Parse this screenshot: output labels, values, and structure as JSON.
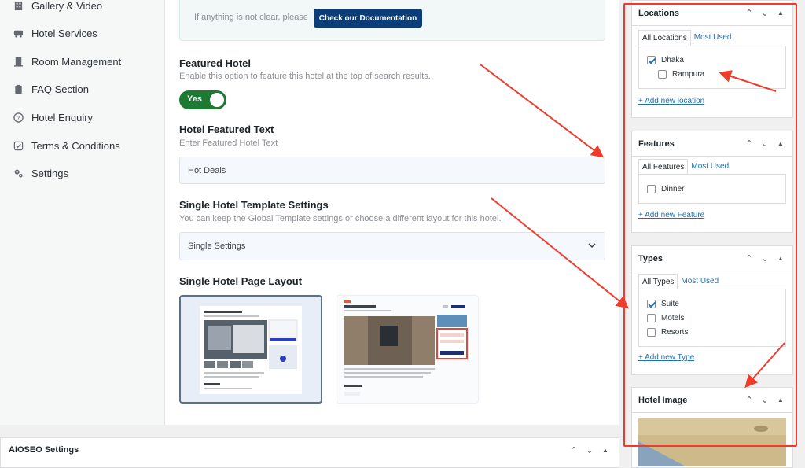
{
  "nav": {
    "items": [
      {
        "label": "Gallery & Video",
        "icon": "building-icon"
      },
      {
        "label": "Hotel Services",
        "icon": "bus-icon"
      },
      {
        "label": "Room Management",
        "icon": "door-icon"
      },
      {
        "label": "FAQ Section",
        "icon": "clipboard-icon"
      },
      {
        "label": "Hotel Enquiry",
        "icon": "question-icon"
      },
      {
        "label": "Terms & Conditions",
        "icon": "checkbox-icon"
      },
      {
        "label": "Settings",
        "icon": "gears-icon"
      }
    ]
  },
  "main": {
    "notice_text": "If anything is not clear, please",
    "doc_button": "Check our Documentation",
    "featured_title": "Featured Hotel",
    "featured_desc": "Enable this option to feature this hotel at the top of search results.",
    "toggle_label": "Yes",
    "featured_text_title": "Hotel Featured Text",
    "featured_text_desc": "Enter Featured Hotel Text",
    "featured_text_value": "Hot Deals",
    "template_title": "Single Hotel Template Settings",
    "template_desc": "You can keep the Global Template settings or choose a different layout for this hotel.",
    "template_value": "Single Settings",
    "layout_title": "Single Hotel Page Layout"
  },
  "aioseo": {
    "title": "AIOSEO Settings"
  },
  "sidebar": {
    "locations": {
      "title": "Locations",
      "tab_all": "All Locations",
      "tab_used": "Most Used",
      "items": [
        {
          "label": "Dhaka",
          "checked": true
        },
        {
          "label": "Rampura",
          "checked": false
        }
      ],
      "add": "+ Add new location"
    },
    "features": {
      "title": "Features",
      "tab_all": "All Features",
      "tab_used": "Most Used",
      "items": [
        {
          "label": "Dinner",
          "checked": false
        }
      ],
      "add": "+ Add new Feature"
    },
    "types": {
      "title": "Types",
      "tab_all": "All Types",
      "tab_used": "Most Used",
      "items": [
        {
          "label": "Suite",
          "checked": true
        },
        {
          "label": "Motels",
          "checked": false
        },
        {
          "label": "Resorts",
          "checked": false
        }
      ],
      "add": "+ Add new Type"
    },
    "image": {
      "title": "Hotel Image"
    }
  },
  "colors": {
    "accent": "#2271b1",
    "toggle": "#1c7a32",
    "doc_button": "#0b3d78",
    "annotation": "#ef3b2c"
  }
}
